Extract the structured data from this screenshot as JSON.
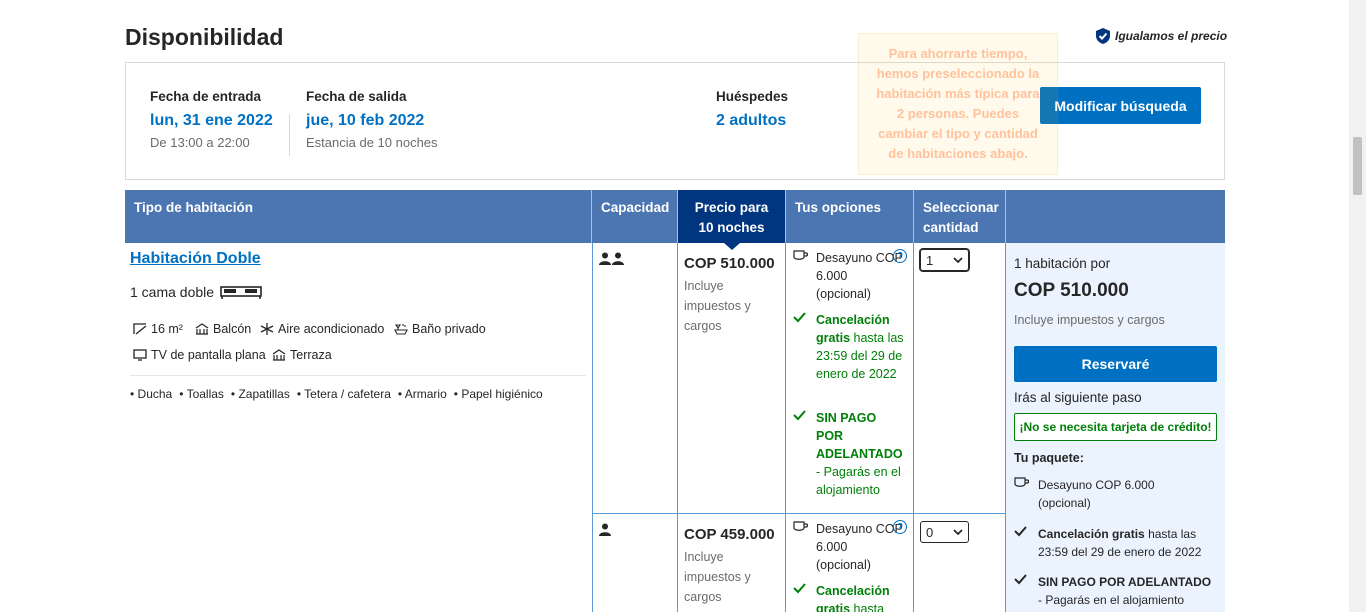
{
  "header": {
    "title": "Disponibilidad",
    "price_match": "Igualamos el precio"
  },
  "search": {
    "checkin_label": "Fecha de entrada",
    "checkin_value": "lun, 31 ene 2022",
    "checkin_sub": "De 13:00 a 22:00",
    "checkout_label": "Fecha de salida",
    "checkout_value": "jue, 10 feb 2022",
    "checkout_sub": "Estancia de 10 noches",
    "guests_label": "Huéspedes",
    "guests_value": "2 adultos",
    "modify_button": "Modificar búsqueda",
    "tooltip": "Para ahorrarte tiempo, hemos preseleccionado la habitación más típica para 2 personas. Puedes cambiar el tipo y cantidad de habitaciones abajo."
  },
  "table": {
    "headers": {
      "room_type": "Tipo de habitación",
      "capacity": "Capacidad",
      "price": "Precio para 10 noches",
      "options": "Tus opciones",
      "quantity": "Seleccionar cantidad"
    },
    "room": {
      "name": "Habitación Doble",
      "bed": "1 cama doble",
      "facilities": [
        "16 m²",
        "Balcón",
        "Aire acondicionado",
        "Baño privado",
        "TV de pantalla plana",
        "Terraza"
      ],
      "amenities": [
        "Ducha",
        "Toallas",
        "Zapatillas",
        "Tetera / cafetera",
        "Armario",
        "Papel higiénico"
      ]
    },
    "rows": [
      {
        "price": "COP 510.000",
        "price_sub": "Incluye impuestos y cargos",
        "breakfast": "Desayuno COP 6.000 (opcional)",
        "cancel_bold": "Cancelación gratis",
        "cancel_rest": "hasta las 23:59 del 29 de enero de 2022",
        "prepay": "SIN PAGO POR ADELANTADO",
        "prepay_sub": "- Pagarás en el alojamiento",
        "qty": "1"
      },
      {
        "price": "COP 459.000",
        "price_sub": "Incluye impuestos y cargos",
        "breakfast": "Desayuno COP 6.000 (opcional)",
        "cancel_bold": "Cancelación gratis",
        "cancel_rest": "hasta",
        "qty": "0"
      }
    ]
  },
  "summary": {
    "rooms_for": "1 habitación por",
    "price": "COP 510.000",
    "price_sub": "Incluye impuestos y cargos",
    "reserve_button": "Reservaré",
    "next_step": "Irás al siguiente paso",
    "no_card": "¡No se necesita tarjeta de crédito!",
    "package_title": "Tu paquete:",
    "package_breakfast": "Desayuno COP 6.000 (opcional)",
    "package_cancel_bold": "Cancelación gratis",
    "package_cancel_rest": "hasta las 23:59 del 29 de enero de 2022",
    "package_prepay": "SIN PAGO POR ADELANTADO",
    "package_prepay_sub": "- Pagarás en el alojamiento"
  },
  "colors": {
    "brand_blue": "#0071c2",
    "header_blue": "#4c76b2",
    "dark_blue": "#003580",
    "green": "#008009",
    "summary_bg": "#ebf3ff"
  },
  "icons": [
    "shield-check-icon",
    "bed-icon",
    "size-icon",
    "balcony-icon",
    "snowflake-icon",
    "bath-icon",
    "tv-icon",
    "terrace-icon",
    "two-persons-icon",
    "one-person-icon",
    "coffee-cup-icon",
    "checkmark-icon",
    "help-icon",
    "chevron-down-icon"
  ]
}
